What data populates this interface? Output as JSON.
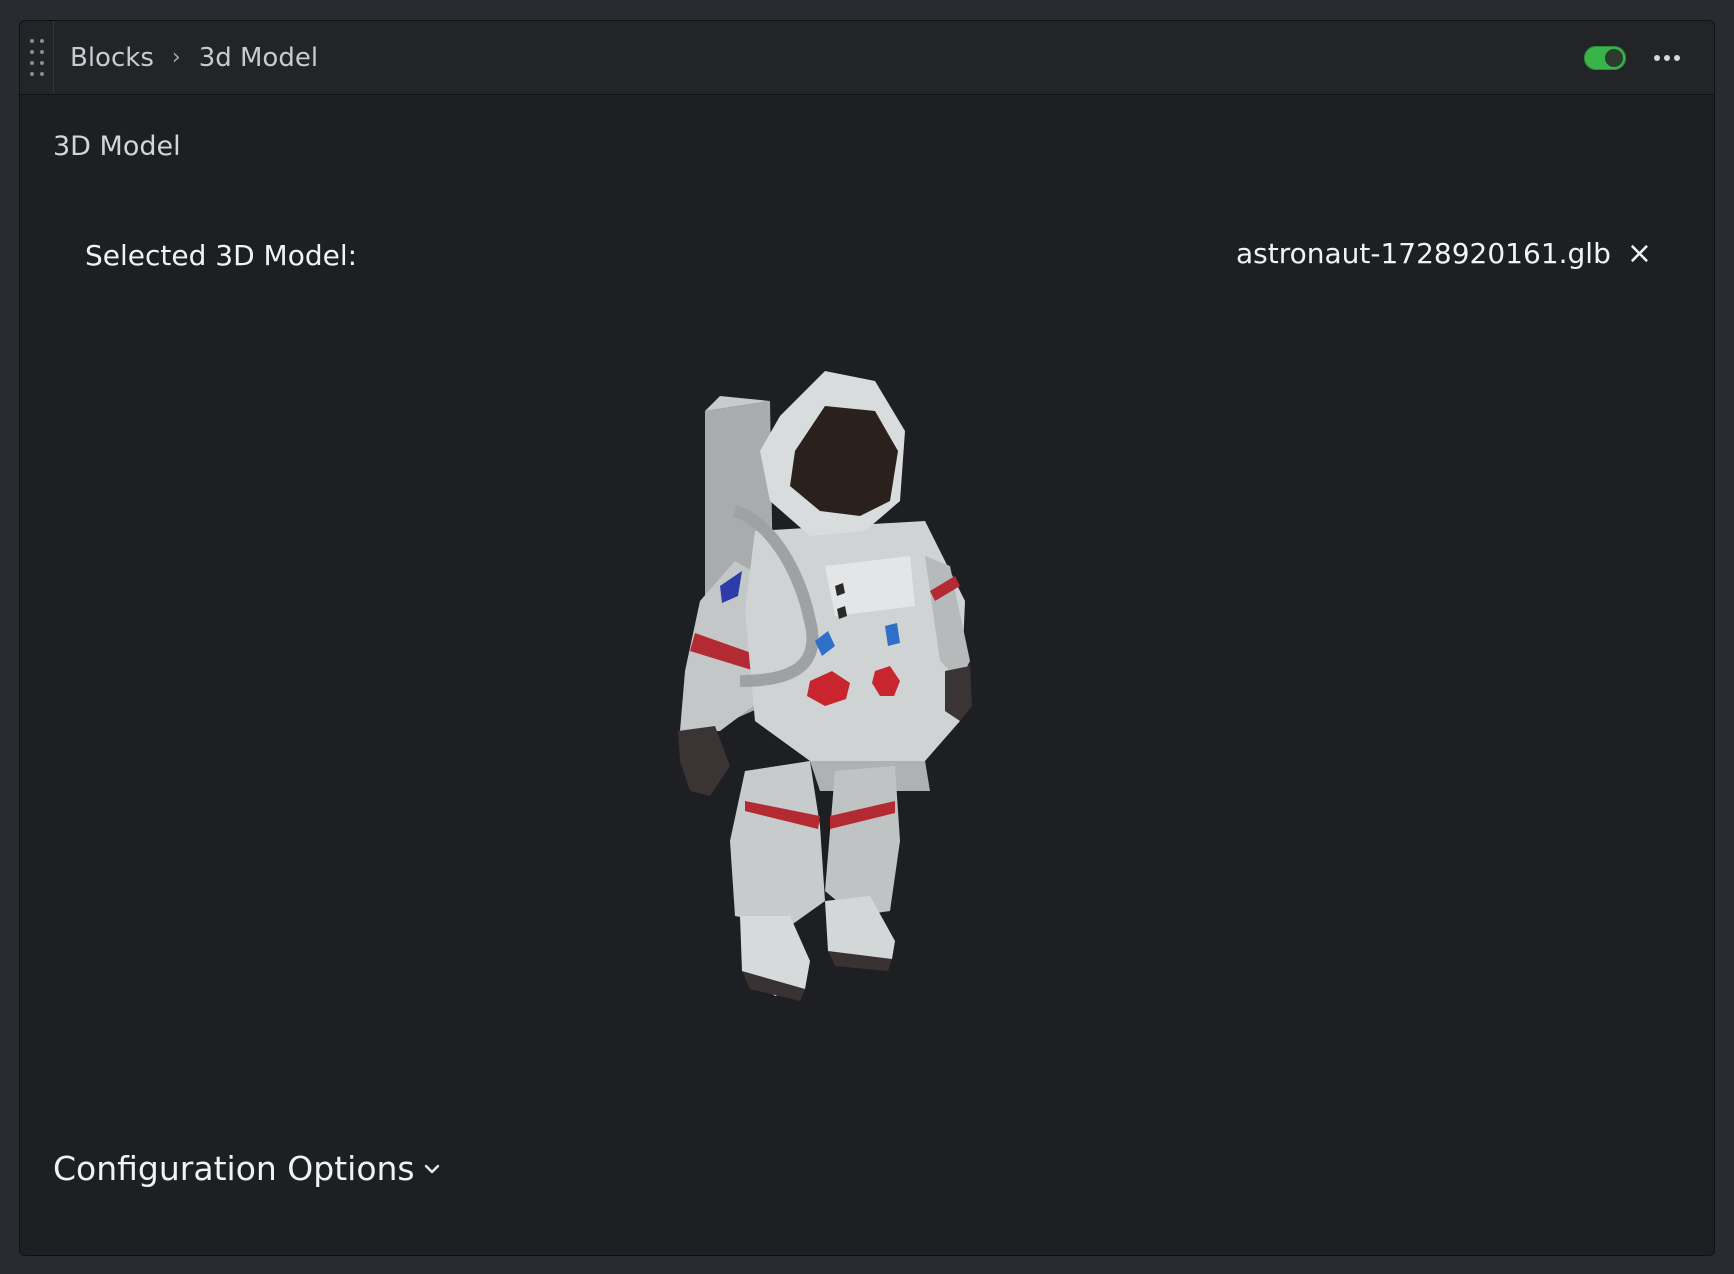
{
  "header": {
    "breadcrumb": [
      "Blocks",
      "3d Model"
    ],
    "breadcrumb_separator": "›",
    "toggle_on": true,
    "toggle_color": "#39b449",
    "more_icon": "more-horizontal-icon"
  },
  "section": {
    "title": "3D Model"
  },
  "model": {
    "label": "Selected 3D Model:",
    "file_name": "astronaut-1728920161.glb",
    "clear_glyph": "×"
  },
  "footer": {
    "config_label": "Configuration Options"
  }
}
